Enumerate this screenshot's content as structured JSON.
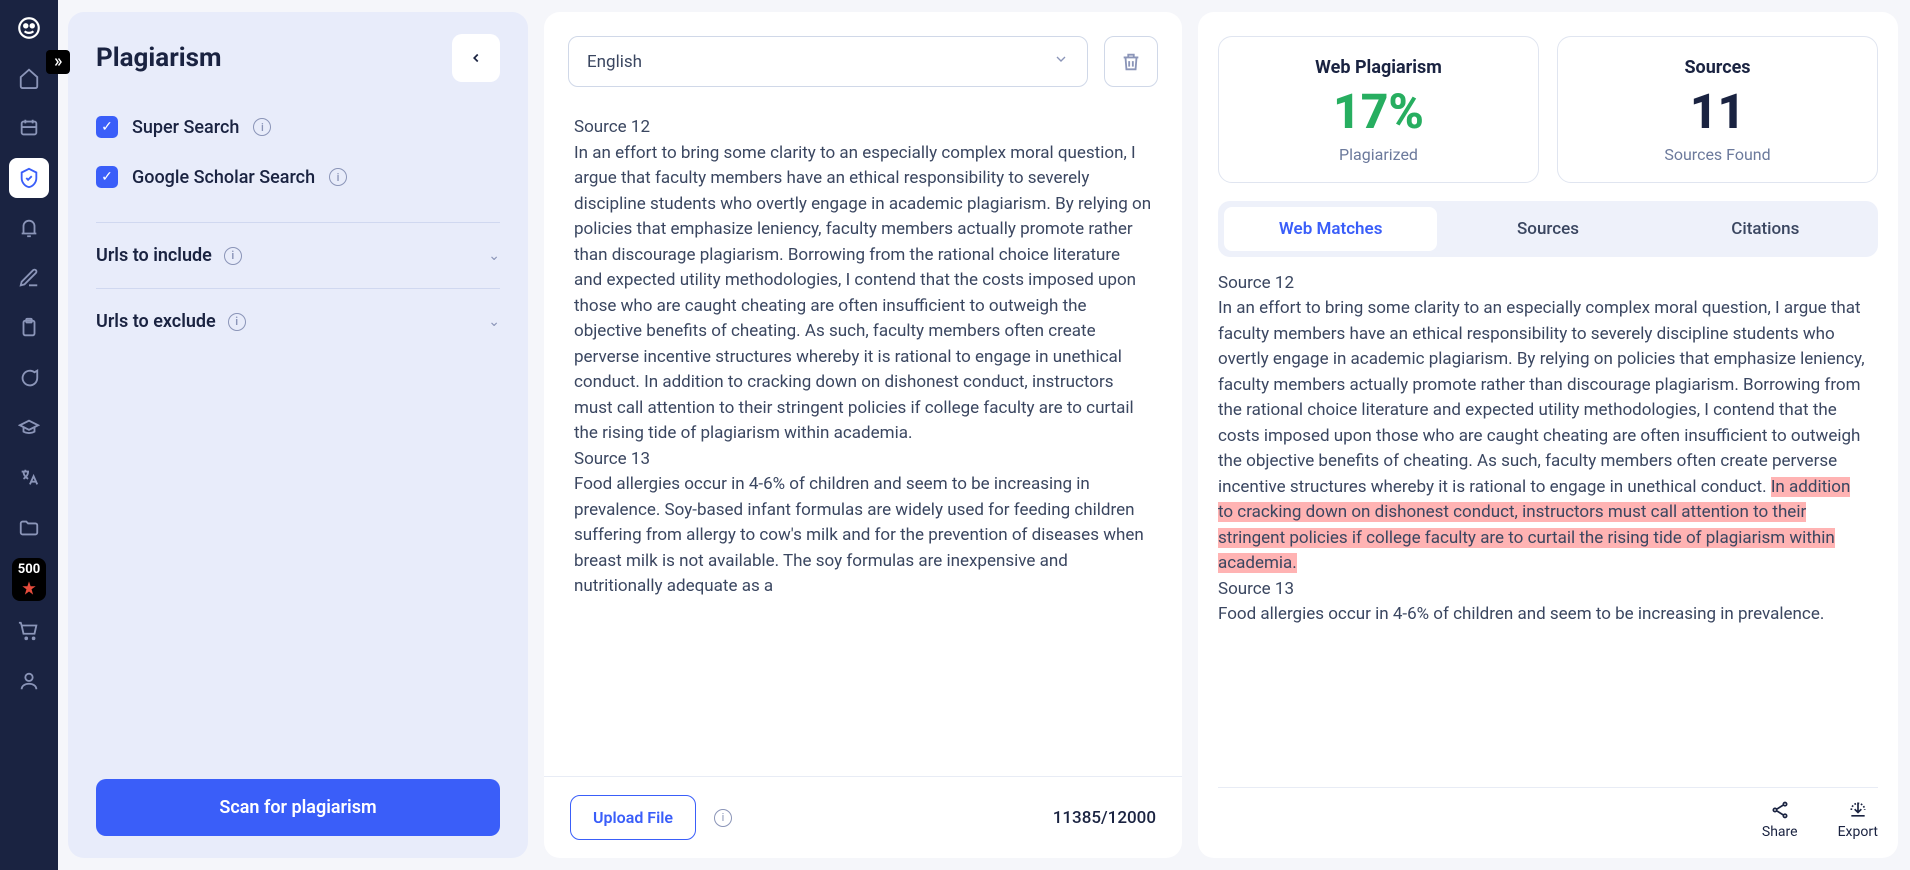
{
  "nav": {
    "badge_value": "500"
  },
  "left": {
    "title": "Plagiarism",
    "opt_super": "Super Search",
    "opt_scholar": "Google Scholar Search",
    "include_label": "Urls to include",
    "exclude_label": "Urls to exclude",
    "scan_btn": "Scan for plagiarism"
  },
  "center": {
    "language": "English",
    "source12_label": "Source 12",
    "source12_text": "In an effort to bring some clarity to an especially complex moral question, I argue that faculty members have an ethical responsibility to severely discipline students who overtly engage in academic plagiarism. By relying on policies that emphasize leniency, faculty members actually promote rather than discourage plagiarism. Borrowing from the rational choice literature and expected utility methodologies, I contend that the costs imposed upon those who are caught cheating are often insufficient to outweigh the objective benefits of cheating. As such, faculty members often create perverse incentive structures whereby it is rational to engage in unethical conduct. In addition to cracking down on dishonest conduct, instructors must call attention to their stringent policies if college faculty are to curtail the rising tide of plagiarism within academia.",
    "source13_label": "Source 13",
    "source13_text": "Food allergies occur in 4-6% of children and seem to be increasing in prevalence. Soy-based infant formulas are widely used for feeding children suffering from allergy to cow's milk and for the prevention of diseases when breast milk is not available. The soy formulas are inexpensive and nutritionally adequate as a",
    "upload_label": "Upload File",
    "char_count": "11385/12000"
  },
  "right": {
    "stat1_title": "Web Plagiarism",
    "stat1_value": "17%",
    "stat1_sub": "Plagiarized",
    "stat2_title": "Sources",
    "stat2_value": "11",
    "stat2_sub": "Sources Found",
    "tab1": "Web Matches",
    "tab2": "Sources",
    "tab3": "Citations",
    "r_source12_label": "Source 12",
    "r_source12_pre": "In an effort to bring some clarity to an especially complex moral question, I argue that faculty members have an ethical responsibility to severely discipline students who overtly engage in academic plagiarism. By relying on policies that emphasize leniency, faculty members actually promote rather than discourage plagiarism. Borrowing from the rational choice literature and expected utility methodologies, I contend that the costs imposed upon those who are caught cheating are often insufficient to outweigh the objective benefits of cheating. As such, faculty members often create perverse incentive structures whereby it is rational to engage in unethical conduct. ",
    "r_source12_hl": "In addition to cracking down on dishonest conduct, instructors must call attention to their stringent policies if college faculty are to curtail the rising tide of plagiarism within academia.",
    "r_source13_label": "Source 13",
    "r_source13_text": "Food allergies occur in 4-6% of children and seem to be increasing in prevalence.",
    "share": "Share",
    "export": "Export"
  }
}
